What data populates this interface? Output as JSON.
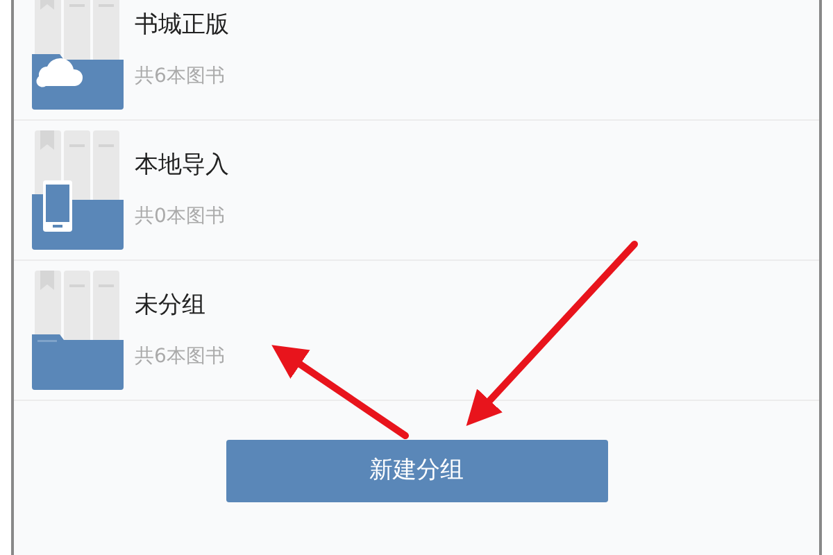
{
  "groups": [
    {
      "name": "书城正版",
      "count": "共6本图书",
      "kind": "cloud"
    },
    {
      "name": "本地导入",
      "count": "共0本图书",
      "kind": "phone"
    },
    {
      "name": "未分组",
      "count": "共6本图书",
      "kind": "plain"
    }
  ],
  "new_group_button": "新建分组"
}
